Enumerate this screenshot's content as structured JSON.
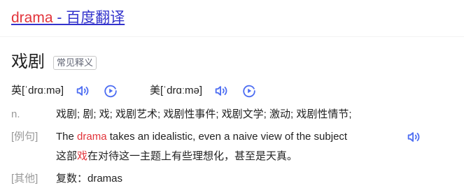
{
  "result_title": {
    "word": "drama",
    "suffix": " - 百度翻译"
  },
  "entry": {
    "headword": "戏剧",
    "tag": "常见释义"
  },
  "pronunciation": {
    "uk_label": "英",
    "uk_phonetic": "[ˈdrɑːmə]",
    "us_label": "美",
    "us_phonetic": "[ˈdrɑːmə]"
  },
  "definition": {
    "pos": "n.",
    "meanings": "戏剧; 剧; 戏; 戏剧艺术; 戏剧性事件; 戏剧文学; 激动; 戏剧性情节;"
  },
  "example": {
    "label": "[例句]",
    "en_before": "The ",
    "en_highlight": "drama",
    "en_after": " takes an idealistic, even a naive view of the subject",
    "cn_before": "这部",
    "cn_highlight": "戏",
    "cn_after": "在对待这一主题上有些理想化，甚至是天真。"
  },
  "other": {
    "label": "[其他]",
    "text": "复数：dramas"
  },
  "colors": {
    "link": "#3333cc",
    "highlight": "#e2333a",
    "icon": "#4e6ef2",
    "muted": "#999999"
  },
  "icons": [
    "speaker-icon",
    "play-icon"
  ]
}
